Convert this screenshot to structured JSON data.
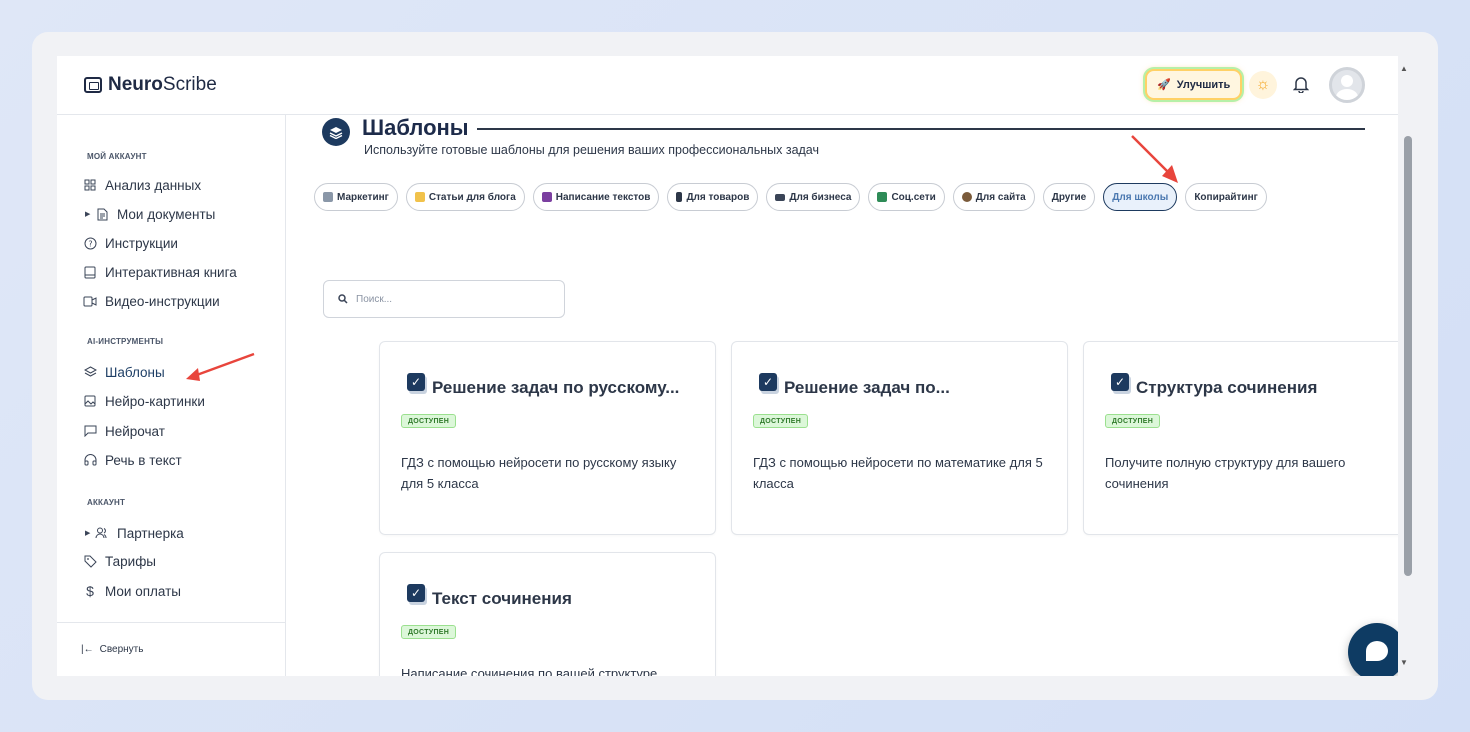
{
  "header": {
    "logo_bold": "Neuro",
    "logo_rest": "Scribe",
    "upgrade_label": "Улучшить"
  },
  "sidebar": {
    "sections": [
      {
        "title": "МОЙ АККАУНТ"
      },
      {
        "title": "AI-ИНСТРУМЕНТЫ"
      },
      {
        "title": "АККАУНТ"
      }
    ],
    "items": [
      {
        "label": "Анализ данных",
        "icon": "grid-icon"
      },
      {
        "label": "Мои документы",
        "icon": "document-icon"
      },
      {
        "label": "Инструкции",
        "icon": "help-circle-icon"
      },
      {
        "label": "Интерактивная книга",
        "icon": "book-icon"
      },
      {
        "label": "Видео-инструкции",
        "icon": "video-icon"
      },
      {
        "label": "Шаблоны",
        "icon": "layers-icon"
      },
      {
        "label": "Нейро-картинки",
        "icon": "image-icon"
      },
      {
        "label": "Нейрочат",
        "icon": "chat-icon"
      },
      {
        "label": "Речь в текст",
        "icon": "headphones-icon"
      },
      {
        "label": "Партнерка",
        "icon": "users-icon"
      },
      {
        "label": "Тарифы",
        "icon": "tag-icon"
      },
      {
        "label": "Мои оплаты",
        "icon": "dollar-icon"
      }
    ],
    "collapse_label": "Свернуть"
  },
  "main": {
    "title": "Шаблоны",
    "subtitle": "Используйте готовые шаблоны для решения ваших профессиональных задач",
    "tabs": [
      {
        "label": "Маркетинг",
        "color": "#6b7a8f"
      },
      {
        "label": "Статьи для блога",
        "color": "#f1c24b"
      },
      {
        "label": "Написание текстов",
        "color": "#7b3fa0"
      },
      {
        "label": "Для товаров",
        "color": "#2d3748"
      },
      {
        "label": "Для бизнеса",
        "color": "#3a4457"
      },
      {
        "label": "Соц.сети",
        "color": "#2e8b57"
      },
      {
        "label": "Для сайта",
        "color": "#7a5a3a"
      },
      {
        "label": "Другие",
        "color": ""
      },
      {
        "label": "Для школы",
        "color": ""
      },
      {
        "label": "Копирайтинг",
        "color": ""
      }
    ],
    "active_tab": "Для школы",
    "search_placeholder": "Поиск...",
    "cards": [
      {
        "title": "Решение задач по русскому...",
        "badge": "ДОСТУПЕН",
        "description": "ГДЗ с помощью нейросети по русскому языку для 5 класса"
      },
      {
        "title": "Решение задач по...",
        "badge": "ДОСТУПЕН",
        "description": "ГДЗ с помощью нейросети по математике для 5 класса"
      },
      {
        "title": "Структура сочинения",
        "badge": "ДОСТУПЕН",
        "description": "Получите полную структуру для вашего сочинения"
      },
      {
        "title": "Текст сочинения",
        "badge": "ДОСТУПЕН",
        "description": "Написание сочинения по вашей структуре"
      }
    ]
  },
  "colors": {
    "accent": "#1d3a5f",
    "badge_bg": "#dcf7d9",
    "annotation_arrow": "#e8453c"
  }
}
